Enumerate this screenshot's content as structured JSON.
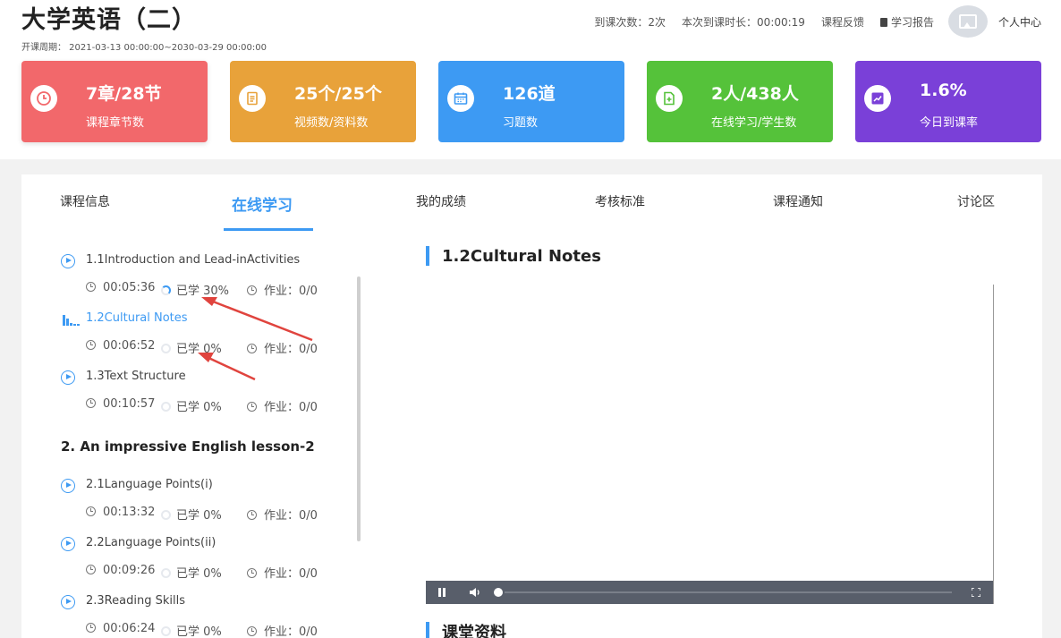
{
  "header": {
    "course_title": "大学英语（二）",
    "period": "开课周期：  2021-03-13 00:00:00~2030-03-29 00:00:00",
    "visits": "到课次数：2次",
    "duration": "本次到课时长：00:00:19",
    "feedback": "课程反馈",
    "report": "学习报告",
    "user_center": "个人中心"
  },
  "stats": [
    {
      "value": "7章/28节",
      "label": "课程章节数",
      "icon": "clock-icon",
      "color": "#f2686b"
    },
    {
      "value": "25个/25个",
      "label": "视频数/资料数",
      "icon": "document-icon",
      "color": "#e8a23a"
    },
    {
      "value": "126道",
      "label": "习题数",
      "icon": "calendar-icon",
      "color": "#3d9af3"
    },
    {
      "value": "2人/438人",
      "label": "在线学习/学生数",
      "icon": "file-add-icon",
      "color": "#55c23a"
    },
    {
      "value": "1.6%",
      "label": "今日到课率",
      "icon": "trend-chart-icon",
      "color": "#7a40d8"
    }
  ],
  "tabs": [
    "课程信息",
    "在线学习",
    "我的成绩",
    "考核标准",
    "课程通知",
    "讨论区"
  ],
  "active_tab": "在线学习",
  "lessons": [
    {
      "title": "1.1Introduction and Lead-inActivities",
      "duration": "00:05:36",
      "progress": "已学 30%",
      "progress_value": 30,
      "homework": "作业：0/0",
      "current": false
    },
    {
      "title": "1.2Cultural Notes",
      "duration": "00:06:52",
      "progress": "已学 0%",
      "progress_value": 0,
      "homework": "作业：0/0",
      "current": true
    },
    {
      "title": "1.3Text Structure",
      "duration": "00:10:57",
      "progress": "已学 0%",
      "progress_value": 0,
      "homework": "作业：0/0",
      "current": false
    },
    {
      "title": "2.1Language Points(i)",
      "duration": "00:13:32",
      "progress": "已学 0%",
      "progress_value": 0,
      "homework": "作业：0/0",
      "current": false
    },
    {
      "title": "2.2Language Points(ii)",
      "duration": "00:09:26",
      "progress": "已学 0%",
      "progress_value": 0,
      "homework": "作业：0/0",
      "current": false
    },
    {
      "title": "2.3Reading Skills",
      "duration": "00:06:24",
      "progress": "已学 0%",
      "progress_value": 0,
      "homework": "作业：0/0",
      "current": false
    }
  ],
  "chapter_2": "2. An impressive English lesson-2",
  "player": {
    "title": "1.2Cultural Notes"
  },
  "materials_title": "课堂资料",
  "colors": {
    "accent": "#3d9af3",
    "arrow": "#e0443e"
  }
}
